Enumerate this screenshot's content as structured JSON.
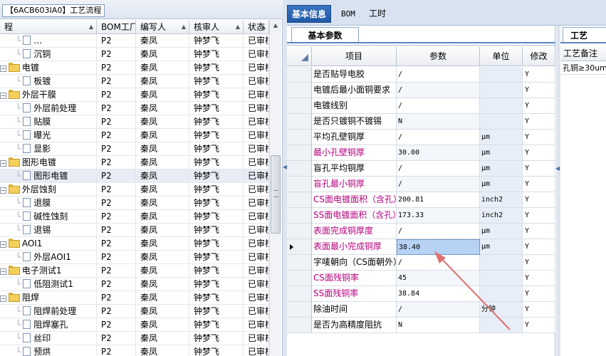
{
  "left_panel": {
    "title": "【6ACB603IA0】工艺流程",
    "columns": [
      "程",
      "BOM工厂",
      "编写人",
      "核审人",
      "状态"
    ],
    "rows": [
      {
        "type": "child",
        "name": "…",
        "bom": "P2",
        "writer": "秦凤",
        "reviewer": "钟梦飞",
        "status": "已审核"
      },
      {
        "type": "child",
        "name": "沉铜",
        "bom": "P2",
        "writer": "秦凤",
        "reviewer": "钟梦飞",
        "status": "已审核"
      },
      {
        "type": "group",
        "name": "电镀",
        "bom": "P2",
        "writer": "秦凤",
        "reviewer": "钟梦飞",
        "status": "已审核"
      },
      {
        "type": "child",
        "name": "板镀",
        "bom": "P2",
        "writer": "秦凤",
        "reviewer": "钟梦飞",
        "status": "已审核"
      },
      {
        "type": "group",
        "name": "外层干膜",
        "bom": "P2",
        "writer": "秦凤",
        "reviewer": "钟梦飞",
        "status": "已审核"
      },
      {
        "type": "child",
        "name": "外层前处理",
        "bom": "P2",
        "writer": "秦凤",
        "reviewer": "钟梦飞",
        "status": "已审核"
      },
      {
        "type": "child",
        "name": "贴膜",
        "bom": "P2",
        "writer": "秦凤",
        "reviewer": "钟梦飞",
        "status": "已审核"
      },
      {
        "type": "child",
        "name": "曝光",
        "bom": "P2",
        "writer": "秦凤",
        "reviewer": "钟梦飞",
        "status": "已审核"
      },
      {
        "type": "child",
        "name": "显影",
        "bom": "P2",
        "writer": "秦凤",
        "reviewer": "钟梦飞",
        "status": "已审核"
      },
      {
        "type": "group",
        "name": "图形电镀",
        "bom": "P2",
        "writer": "秦凤",
        "reviewer": "钟梦飞",
        "status": "已审核"
      },
      {
        "type": "child",
        "name": "图形电镀",
        "bom": "P2",
        "writer": "秦凤",
        "reviewer": "钟梦飞",
        "status": "已审核",
        "selected": true
      },
      {
        "type": "group",
        "name": "外层蚀刻",
        "bom": "P2",
        "writer": "秦凤",
        "reviewer": "钟梦飞",
        "status": "已审核"
      },
      {
        "type": "child",
        "name": "退膜",
        "bom": "P2",
        "writer": "秦凤",
        "reviewer": "钟梦飞",
        "status": "已审核"
      },
      {
        "type": "child",
        "name": "碱性蚀刻",
        "bom": "P2",
        "writer": "秦凤",
        "reviewer": "钟梦飞",
        "status": "已审核"
      },
      {
        "type": "child",
        "name": "退锡",
        "bom": "P2",
        "writer": "秦凤",
        "reviewer": "钟梦飞",
        "status": "已审核"
      },
      {
        "type": "group",
        "name": "AOI1",
        "bom": "P2",
        "writer": "秦凤",
        "reviewer": "钟梦飞",
        "status": "已审核"
      },
      {
        "type": "child",
        "name": "外层AOI1",
        "bom": "P2",
        "writer": "秦凤",
        "reviewer": "钟梦飞",
        "status": "已审核"
      },
      {
        "type": "group",
        "name": "电子测试1",
        "bom": "P2",
        "writer": "秦凤",
        "reviewer": "钟梦飞",
        "status": "已审核"
      },
      {
        "type": "child",
        "name": "低阻测试1",
        "bom": "P2",
        "writer": "秦凤",
        "reviewer": "钟梦飞",
        "status": "已审核"
      },
      {
        "type": "group",
        "name": "阻焊",
        "bom": "P2",
        "writer": "秦凤",
        "reviewer": "钟梦飞",
        "status": "已审核"
      },
      {
        "type": "child",
        "name": "阻焊前处理",
        "bom": "P2",
        "writer": "秦凤",
        "reviewer": "钟梦飞",
        "status": "已审核"
      },
      {
        "type": "child",
        "name": "阻焊塞孔",
        "bom": "P2",
        "writer": "秦凤",
        "reviewer": "钟梦飞",
        "status": "已审核"
      },
      {
        "type": "child",
        "name": "丝印",
        "bom": "P2",
        "writer": "秦凤",
        "reviewer": "钟梦飞",
        "status": "已审核"
      },
      {
        "type": "child",
        "name": "预烘",
        "bom": "P2",
        "writer": "秦凤",
        "reviewer": "钟梦飞",
        "status": "已审核"
      },
      {
        "type": "child",
        "name": "曝光",
        "bom": "P2",
        "writer": "秦凤",
        "reviewer": "钟梦飞",
        "status": "已审核"
      }
    ]
  },
  "main_tabs": [
    {
      "label": "基本信息",
      "active": true
    },
    {
      "label": "BOM",
      "active": false
    },
    {
      "label": "工时",
      "active": false
    }
  ],
  "param_panel": {
    "sub_tab": "基本参数",
    "columns": {
      "name": "项目",
      "value": "参数",
      "unit": "单位",
      "modify": "修改"
    },
    "rows": [
      {
        "name": "是否贴导电胶",
        "value": "/",
        "unit": "",
        "modify": "Y"
      },
      {
        "name": "电镀后最小面铜要求",
        "value": "/",
        "unit": "",
        "modify": "Y"
      },
      {
        "name": "电镀线别",
        "value": "/",
        "unit": "",
        "modify": "Y"
      },
      {
        "name": "是否只镀铜不镀锡",
        "value": "N",
        "unit": "",
        "modify": "Y"
      },
      {
        "name": "平均孔壁铜厚",
        "value": "/",
        "unit": "μm",
        "modify": "Y"
      },
      {
        "name": "最小孔壁铜厚",
        "value": "30.00",
        "unit": "μm",
        "modify": "Y",
        "highlight": true
      },
      {
        "name": "盲孔平均铜厚",
        "value": "/",
        "unit": "μm",
        "modify": "Y"
      },
      {
        "name": "盲孔最小铜厚",
        "value": "/",
        "unit": "μm",
        "modify": "Y",
        "highlight": true
      },
      {
        "name": "CS面电镀面积（含孔）",
        "value": "200.81",
        "unit": "inch2",
        "modify": "Y",
        "highlight": true
      },
      {
        "name": "SS面电镀面积（含孔）",
        "value": "173.33",
        "unit": "inch2",
        "modify": "Y",
        "highlight": true
      },
      {
        "name": "表面完成铜厚度",
        "value": "/",
        "unit": "μm",
        "modify": "Y",
        "highlight": true
      },
      {
        "name": "表面最小完成铜厚",
        "value": "38.40",
        "unit": "μm",
        "modify": "Y",
        "highlight": true,
        "current": true
      },
      {
        "name": "字唛朝向（CS面朝外）",
        "value": "/",
        "unit": "",
        "modify": "Y"
      },
      {
        "name": "CS面残铜率",
        "value": "45",
        "unit": "",
        "modify": "Y",
        "highlight": true
      },
      {
        "name": "SS面残铜率",
        "value": "38.84",
        "unit": "",
        "modify": "Y",
        "highlight": true
      },
      {
        "name": "除油时间",
        "value": "/",
        "unit": "分钟",
        "modify": "Y"
      },
      {
        "name": "是否为高精度阻抗",
        "value": "N",
        "unit": "",
        "modify": "Y"
      }
    ]
  },
  "right_panel": {
    "tab": "工艺",
    "header": "工艺备注",
    "note": "孔铜≥30um"
  },
  "colors": {
    "highlight_text": "#b5007e",
    "active_tab": "#2a64b2",
    "annotation_arrow": "#e07070"
  }
}
